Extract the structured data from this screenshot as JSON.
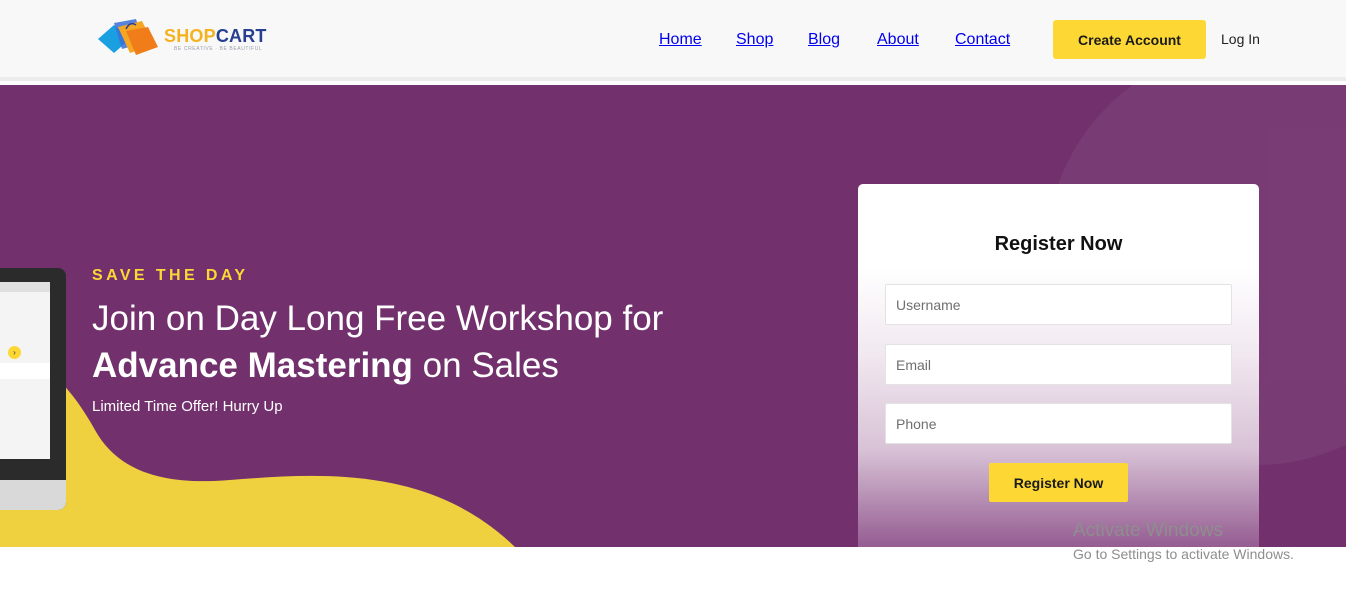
{
  "brand": {
    "name_part1": "SHOP",
    "name_part2": "CART",
    "tagline": "BE CREATIVE · BE BEAUTIFUL",
    "colors": {
      "shop": "#f5b21f",
      "cart": "#283f8f"
    }
  },
  "nav": {
    "items": [
      "Home",
      "Shop",
      "Blog",
      "About",
      "Contact"
    ],
    "create_account": "Create Account",
    "login": "Log In"
  },
  "hero": {
    "eyebrow": "SAVE THE DAY",
    "headline_line1": "Join on Day Long Free Workshop for",
    "headline_bold": "Advance Mastering",
    "headline_rest": "on Sales",
    "subtext": "Limited Time Offer! Hurry Up",
    "background_color": "#72316d",
    "accent_color": "#fdd835"
  },
  "register": {
    "title": "Register Now",
    "username_placeholder": "Username",
    "email_placeholder": "Email",
    "phone_placeholder": "Phone",
    "button": "Register Now"
  },
  "watermark": {
    "title": "Activate Windows",
    "subtitle": "Go to Settings to activate Windows."
  }
}
